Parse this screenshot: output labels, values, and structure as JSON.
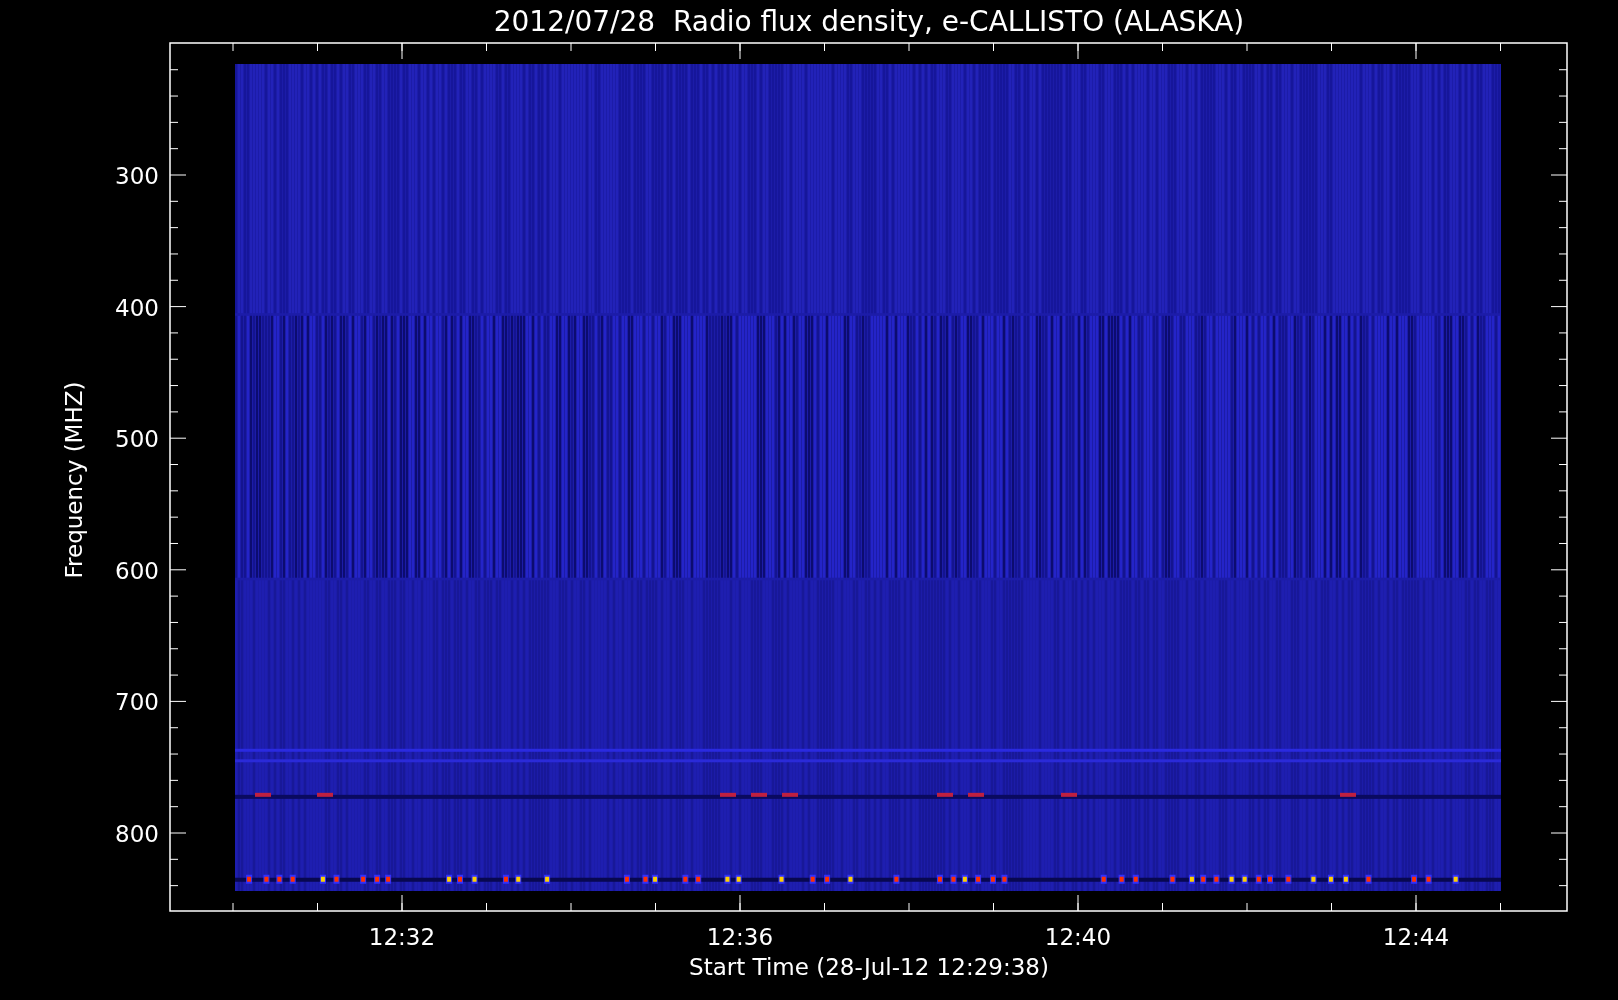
{
  "plot": {
    "title": "2012/07/28  Radio flux density, e-CALLISTO (ALASKA)",
    "y_axis": {
      "label": "Frequency (MHZ)",
      "ticks": [
        "300",
        "400",
        "500",
        "600",
        "700",
        "800"
      ]
    },
    "x_axis": {
      "label": "Start Time (28-Jul-12 12:29:38)",
      "ticks": [
        "12:32",
        "12:36",
        "12:40",
        "12:44"
      ]
    }
  }
}
